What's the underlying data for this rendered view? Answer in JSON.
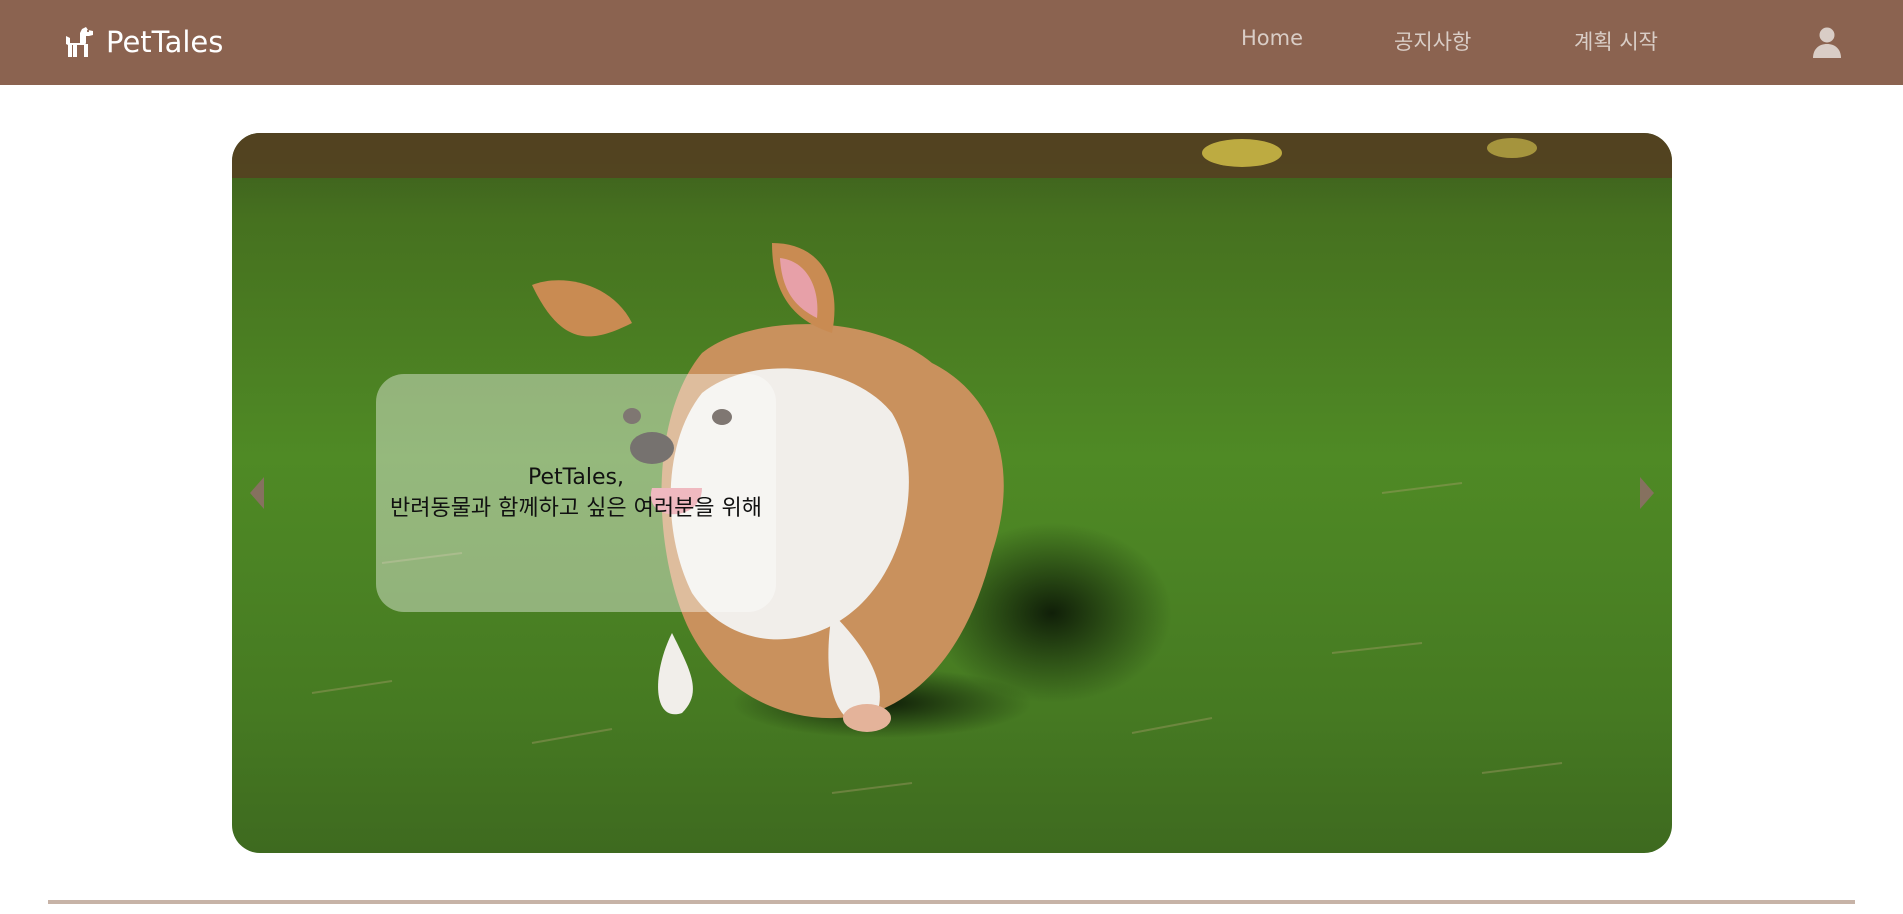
{
  "header": {
    "brand_name": "PetTales",
    "brand_icon": "dog-icon",
    "nav": [
      {
        "label": "Home"
      },
      {
        "label": "공지사항"
      },
      {
        "label": "계획 시작"
      }
    ],
    "user_icon": "user-icon"
  },
  "hero": {
    "caption_line1": "PetTales,",
    "caption_line2": "반려동물과 함께하고 싶은 여러분을 위해",
    "prev_icon": "chevron-left-icon",
    "next_icon": "chevron-right-icon"
  },
  "colors": {
    "navbar_bg": "#8b6350",
    "nav_text": "#d9cdc6",
    "divider": "#c7b3a7"
  }
}
